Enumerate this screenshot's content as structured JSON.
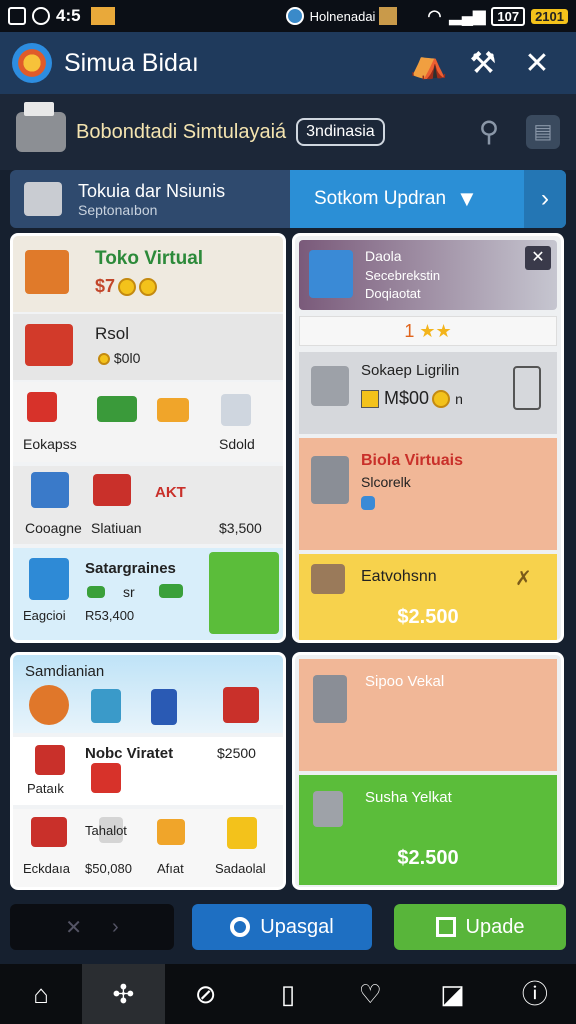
{
  "status": {
    "time": "4:5",
    "notif": "Holnenadai",
    "battery": "107",
    "badge": "2101"
  },
  "app": {
    "title": "Simua Bidaı",
    "icons": [
      "shop-icon",
      "tools-icon",
      "close-icon"
    ]
  },
  "sub": {
    "title": "Bobondtadi Simtulayaiá",
    "chip": "3ndinasia"
  },
  "banner": {
    "title": "Tokuia dar Nsiunis",
    "subtitle": "Septonaıbon",
    "action": "Sotkom Updran"
  },
  "left1": {
    "shop_title": "Toko Virtual",
    "shop_price": "$7",
    "item_title": "Rsol",
    "item_price": "$0l0",
    "row3": [
      "Eokapss",
      "Sdold"
    ],
    "row4": [
      "Cooagne",
      "Slatiuan",
      "AKT",
      "$3,500"
    ],
    "row5_title": "Satargraines",
    "row5_s": "sr",
    "row5_labels": [
      "Eagcioi",
      "R53,400"
    ]
  },
  "right1": {
    "card_title": "Daola",
    "card_sub": "Secebrekstin",
    "card_sub2": "Doqiaotat",
    "rating": "1",
    "item1_title": "Sokaep Ligrilin",
    "item1_price": "M$00",
    "item1_suffix": "n",
    "item2_title": "Biola Virtuais",
    "item2_sub": "Slcorelk",
    "item3_title": "Eatvohsnn",
    "item3_price": "$2.500"
  },
  "left2": {
    "title": "Samdianian",
    "item_title": "Nobc Viratet",
    "item_price": "$2500",
    "item_lbl": "Pataık",
    "bottom": [
      "Eckdaıa",
      "Tahalot",
      "$50,080",
      "Afıat",
      "Sadaolal"
    ]
  },
  "right2": {
    "item1": "Sipoo Vekal",
    "item2": "Susha Yelkat",
    "price": "$2.500"
  },
  "actions": {
    "btn1": "Upasgal",
    "btn2": "Upade"
  },
  "colors": {
    "accent": "#2b8fd6",
    "green": "#5bbd3a",
    "yellow": "#f7d24c",
    "peach": "#f1b797"
  }
}
